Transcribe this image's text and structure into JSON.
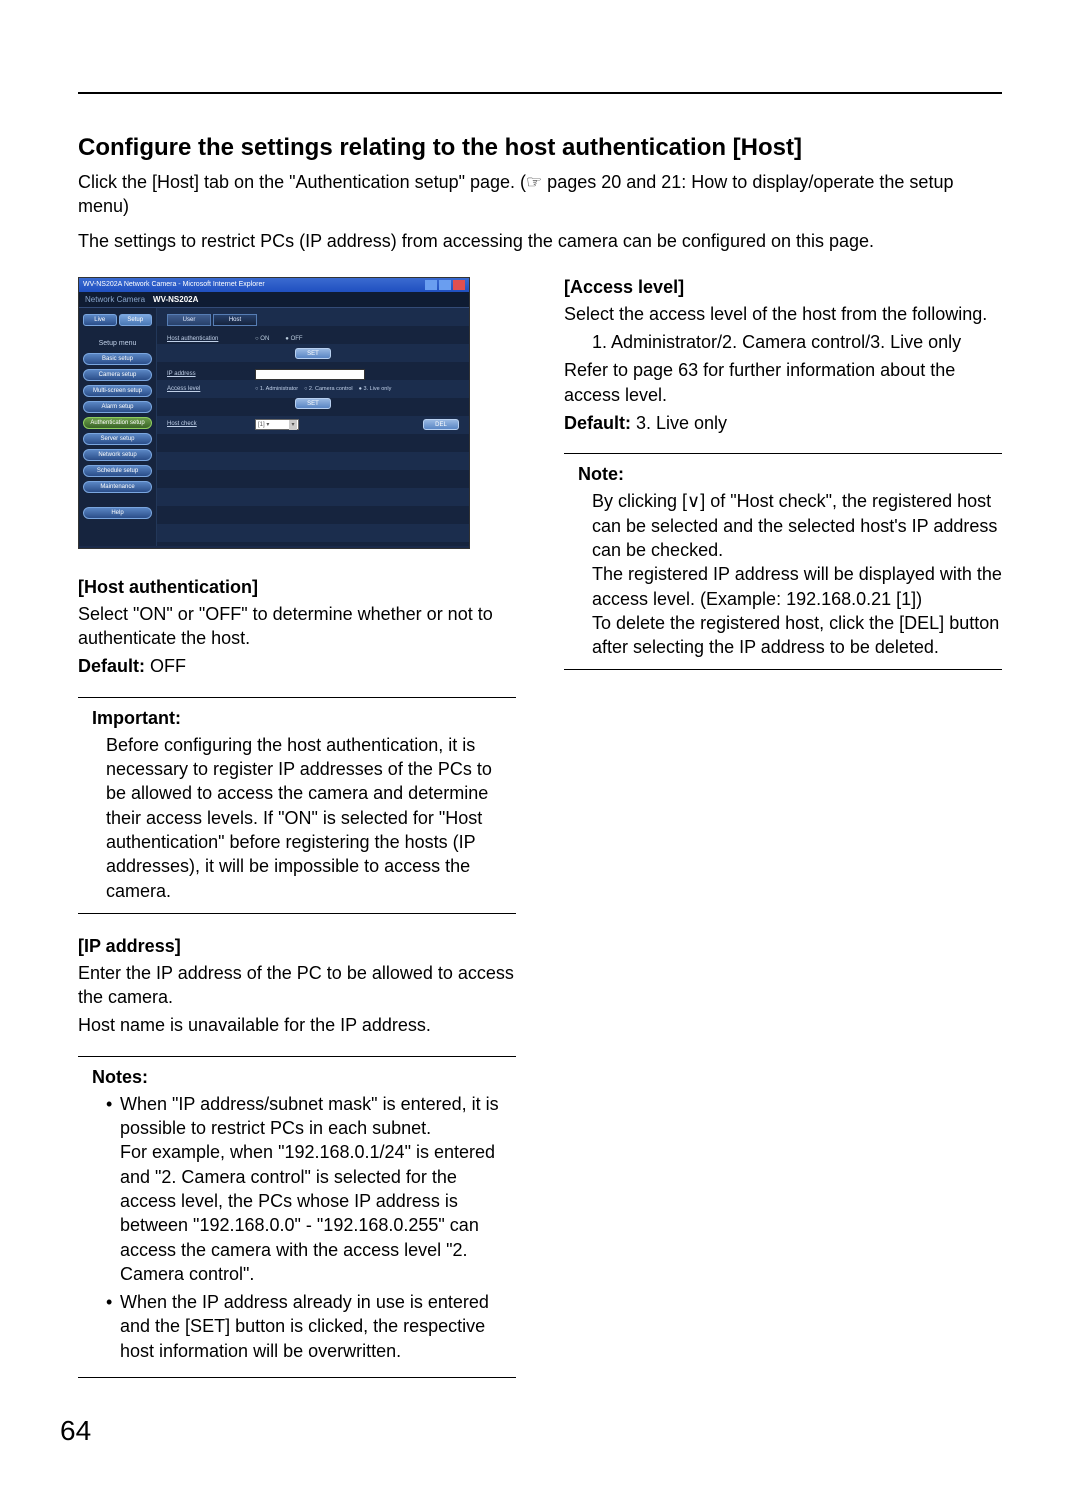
{
  "page_number": "64",
  "title": "Configure the settings relating to the host authentication [Host]",
  "intro_1": "Click the [Host] tab on the \"Authentication setup\" page. (☞ pages 20 and 21: How to display/operate the setup menu)",
  "intro_2": "The settings to restrict PCs (IP address) from accessing the camera can be configured on this page.",
  "screenshot": {
    "window_title": "WV-NS202A Network Camera - Microsoft Internet Explorer",
    "brand_label": "Network Camera",
    "model": "WV-NS202A",
    "model2": "WV-NS202A",
    "tabs": {
      "live": "Live",
      "setup": "Setup"
    },
    "subtabs": {
      "user": "User",
      "host": "Host"
    },
    "setup_menu_title": "Setup menu",
    "sidebar": {
      "items": [
        "Basic setup",
        "Camera setup",
        "Multi-screen setup",
        "Alarm setup",
        "Authentication setup",
        "Server setup",
        "Network setup",
        "Schedule setup",
        "Maintenance"
      ],
      "help": "Help"
    },
    "fields": {
      "host_auth_label": "Host authentication",
      "on": "ON",
      "off": "OFF",
      "set": "SET",
      "ip_label": "IP address",
      "access_label": "Access level",
      "access_opts": [
        "○ 1. Administrator",
        "○ 2. Camera control",
        "● 3. Live only"
      ],
      "host_check_label": "Host check",
      "host_check_value": "[1] ▾",
      "del": "DEL"
    }
  },
  "left": {
    "host_auth": {
      "heading": "[Host authentication]",
      "body": "Select \"ON\" or \"OFF\" to determine whether or not to authenticate the host.",
      "default_label": "Default:",
      "default_value": " OFF"
    },
    "important": {
      "title": "Important:",
      "body": "Before configuring the host authentication, it is necessary to register IP addresses of the PCs to be allowed to access the camera and determine their access levels. If \"ON\" is selected for \"Host authentication\" before registering the hosts (IP addresses), it will be impossible to access the camera."
    },
    "ip": {
      "heading": "[IP address]",
      "body_1": "Enter the IP address of the PC to be allowed to access the camera.",
      "body_2": "Host name is unavailable for the IP address."
    },
    "notes": {
      "title": "Notes:",
      "items": [
        "When \"IP address/subnet mask\" is entered, it is possible to restrict PCs in each subnet.\nFor example, when \"192.168.0.1/24\" is entered and \"2. Camera control\" is selected for the access level, the PCs whose IP address is between \"192.168.0.0\" - \"192.168.0.255\" can access the camera with the access level \"2. Camera control\".",
        "When the IP address already in use is entered and the [SET] button is clicked, the respective host information will be overwritten."
      ]
    }
  },
  "right": {
    "access": {
      "heading": "[Access level]",
      "body_1": "Select the access level of the host from the following.",
      "body_2": "1. Administrator/2. Camera control/3. Live only",
      "body_3": "Refer to page 63 for further information about the access level.",
      "default_label": "Default:",
      "default_value": " 3. Live only"
    },
    "note": {
      "title": "Note:",
      "body_1": "By clicking [∨] of \"Host check\", the registered host can be selected and the selected host's IP address can be checked.",
      "body_2": "The registered IP address will be displayed with the access level. (Example: 192.168.0.21 [1])",
      "body_3": "To delete the registered host, click the [DEL] button after selecting the IP address to be deleted."
    }
  }
}
